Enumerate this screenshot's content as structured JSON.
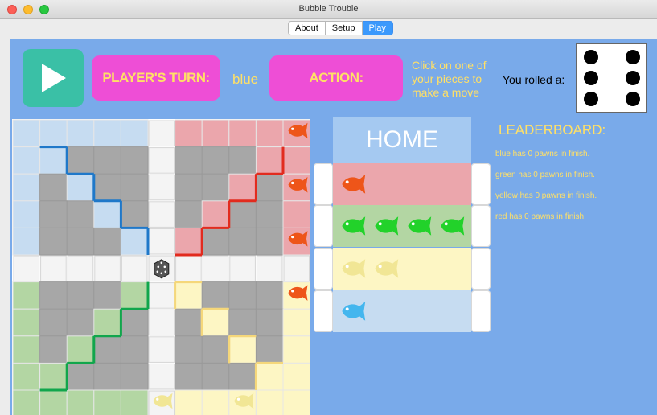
{
  "window": {
    "title": "Bubble Trouble"
  },
  "tabs": [
    {
      "label": "About",
      "active": false
    },
    {
      "label": "Setup",
      "active": false
    },
    {
      "label": "Play",
      "active": true
    }
  ],
  "turn": {
    "label": "PLAYER'S TURN:",
    "color_name": "blue"
  },
  "action": {
    "label": "ACTION:",
    "instruction": "Click on one of your pieces to make a move"
  },
  "dice": {
    "label": "You rolled a:",
    "value": 6
  },
  "home": {
    "title": "HOME",
    "rows": [
      {
        "player": "red",
        "fish_count": 1,
        "lane_color": "#eba6ac",
        "fish_color": "#ee5519"
      },
      {
        "player": "green",
        "fish_count": 4,
        "lane_color": "#b3d6a3",
        "fish_color": "#22d22a"
      },
      {
        "player": "yellow",
        "fish_count": 2,
        "lane_color": "#fdf6c4",
        "fish_color": "#f1e695"
      },
      {
        "player": "blue",
        "fish_count": 1,
        "lane_color": "#c6dcf1",
        "fish_color": "#44b6ee"
      }
    ]
  },
  "leaderboard": {
    "title": "LEADERBOARD:",
    "lines": [
      "blue has 0 pawns in finish.",
      "green has 0 pawns in finish.",
      "yellow has 0 pawns in finish.",
      "red has 0 pawns in finish."
    ]
  },
  "board": {
    "colors": {
      "blue": "#c6dcf1",
      "blue_edge": "#1f78c9",
      "red": "#eba6ac",
      "red_edge": "#e22b1e",
      "green": "#b3d6a3",
      "green_edge": "#11a64c",
      "yellow": "#fdf6c4",
      "yellow_edge": "#f5d77a",
      "gray": "#a7a7a7",
      "track": "#f4f4f4"
    },
    "pieces": [
      {
        "color": "red",
        "name": "red-fish-1"
      },
      {
        "color": "red",
        "name": "red-fish-2"
      },
      {
        "color": "red",
        "name": "red-fish-3"
      },
      {
        "color": "red",
        "name": "red-fish-4"
      },
      {
        "color": "yellow",
        "name": "yellow-fish-1"
      },
      {
        "color": "yellow",
        "name": "yellow-fish-2"
      }
    ]
  },
  "colors": {
    "panel_bg": "#79aaea",
    "play_button": "#3ac0a6",
    "pill": "#ee4ed6",
    "accent_text": "#ffe066"
  }
}
